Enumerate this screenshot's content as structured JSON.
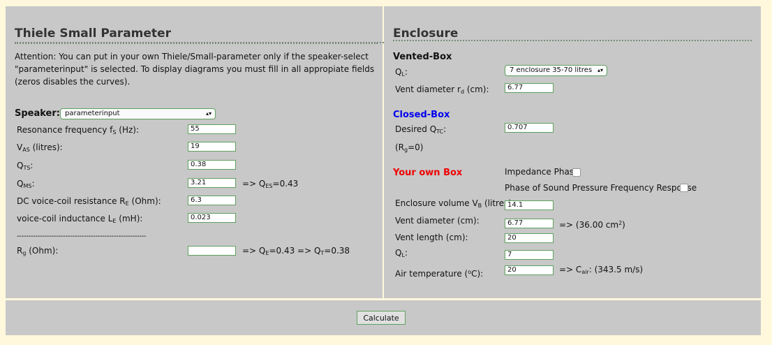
{
  "left": {
    "title": "Thiele Small Parameter",
    "attention": [
      "Attention: You can put in your own Thiele/Small-parameter only if the speaker-select",
      "\"parameterinput\" is selected. To display diagrams you must fill in all appropiate fields",
      "(zeros disables the curves)."
    ],
    "speaker_label": "Speaker:",
    "speaker_value": "parameterinput",
    "fs_label": "Resonance frequency f",
    "fs_sub": "S",
    "fs_unit": " (Hz):",
    "fs_value": "55",
    "vas_label": "V",
    "vas_sub": "AS",
    "vas_unit": " (litres):",
    "vas_value": "19",
    "qts_label": "Q",
    "qts_sub": "TS",
    "qts_unit": ":",
    "qts_value": "0.38",
    "qms_label": "Q",
    "qms_sub": "MS",
    "qms_unit": ":",
    "qms_value": "3.21",
    "qes_result_pre": "=> Q",
    "qes_result_sub": "ES",
    "qes_result_val": "=0.43",
    "re_label": "DC voice-coil resistance R",
    "re_sub": "E",
    "re_unit": " (Ohm):",
    "re_value": "6.3",
    "le_label": "voice-coil inductance L",
    "le_sub": "E",
    "le_unit": " (mH):",
    "le_value": "0.023",
    "separator": "--------------------------------------------------------",
    "rg_label": "R",
    "rg_sub": "g",
    "rg_unit": " (Ohm):",
    "rg_value": "",
    "rg_result_a": "=> Q",
    "rg_result_a_sub": "E",
    "rg_result_b": "=0.43 => Q",
    "rg_result_b_sub": "T",
    "rg_result_c": "=0.38"
  },
  "right": {
    "title": "Enclosure",
    "vented_head": "Vented-Box",
    "ql_label": "Q",
    "ql_sub": "L",
    "ql_unit": ":",
    "ql_select_value": "7 enclosure 35-70 litres",
    "vent_d_label": "Vent diameter r",
    "vent_d_sub": "d",
    "vent_d_unit": " (cm):",
    "vent_d_value": "6.77",
    "closed_head": "Closed-Box",
    "qtc_label": "Desired Q",
    "qtc_sub": "TC",
    "qtc_unit": ":",
    "qtc_value": "0.707",
    "rg0_pre": "(R",
    "rg0_sub": "g",
    "rg0_post": "=0)",
    "own_head": "Your own Box",
    "impedance_label": "Impedance Phase",
    "spl_phase_label": "Phase of Sound Pressure Frequency Response",
    "vb_label": "Enclosure volume V",
    "vb_sub": "B",
    "vb_unit": " (litres):",
    "vb_value": "14.1",
    "vd_label": "Vent diameter (cm):",
    "vd_value": "6.77",
    "vd_result_pre": "=> (36.00 cm",
    "vd_result_sup": "2",
    "vd_result_post": ")",
    "vl_label": "Vent length (cm):",
    "vl_value": "20",
    "ql2_label": "Q",
    "ql2_sub": "L",
    "ql2_unit": ":",
    "ql2_value": "7",
    "air_label": "Air temperature (",
    "air_sup": "o",
    "air_unit": "C):",
    "air_value": "20",
    "air_result_pre": "=> C",
    "air_result_sub": "air",
    "air_result_post": ": (343.5 m/s)"
  },
  "bottom": {
    "calculate_label": "Calculate"
  },
  "colors": {
    "closed_head": "#0000ee",
    "own_head": "#ee0000",
    "panel": "#c8c8c8",
    "page": "#fff8dc"
  }
}
